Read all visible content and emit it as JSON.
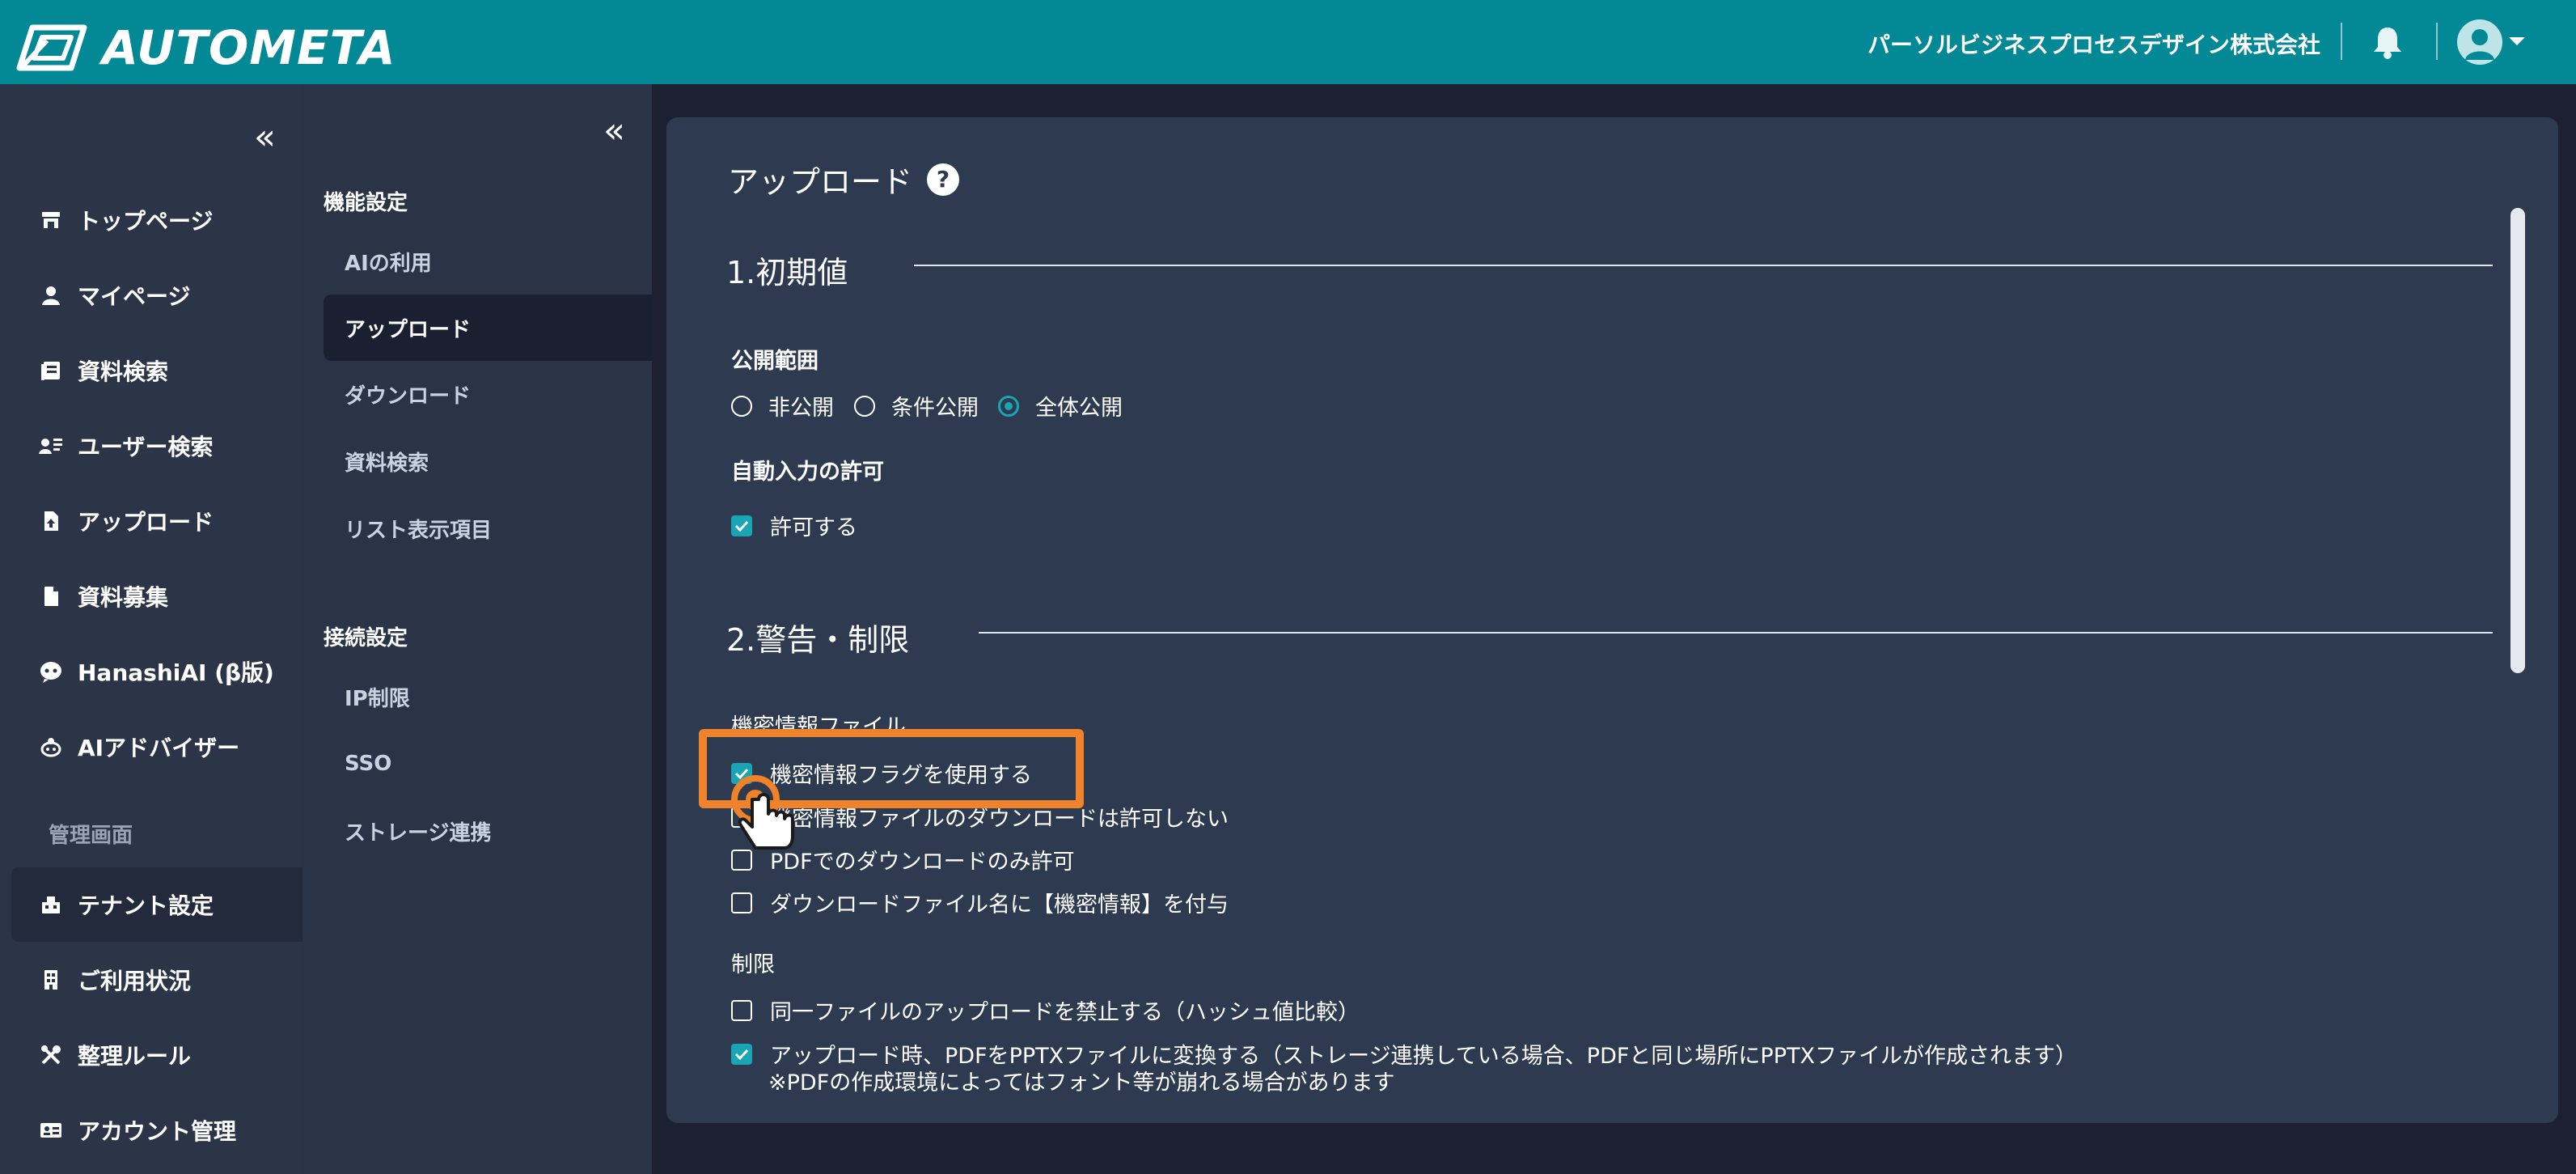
{
  "header": {
    "brand": "AUTOMETA",
    "company": "パーソルビジネスプロセスデザイン株式会社",
    "colors": {
      "bar": "#038895",
      "accent": "#1aa5b4",
      "highlight": "#f08229"
    },
    "icons": [
      "logo-icon",
      "bell-icon",
      "user-avatar-icon",
      "caret-down-icon"
    ]
  },
  "sidebar": {
    "collapse_label": "«",
    "items": [
      {
        "label": "トップページ",
        "icon": "store-icon"
      },
      {
        "label": "マイページ",
        "icon": "person-icon"
      },
      {
        "label": "資料検索",
        "icon": "document-search-icon"
      },
      {
        "label": "ユーザー検索",
        "icon": "user-search-icon"
      },
      {
        "label": "アップロード",
        "icon": "file-upload-icon"
      },
      {
        "label": "資料募集",
        "icon": "file-icon"
      },
      {
        "label": "HanashiAI (β版)",
        "icon": "chat-bot-icon"
      },
      {
        "label": "AIアドバイザー",
        "icon": "advisor-icon"
      }
    ],
    "admin_section": "管理画面",
    "admin_items": [
      {
        "label": "テナント設定",
        "icon": "tenant-icon",
        "active": true
      },
      {
        "label": "ご利用状況",
        "icon": "building-icon"
      },
      {
        "label": "整理ルール",
        "icon": "tools-icon"
      },
      {
        "label": "アカウント管理",
        "icon": "id-card-icon"
      }
    ]
  },
  "subnav": {
    "collapse_label": "«",
    "group1": "機能設定",
    "group1_items": [
      "AIの利用",
      "アップロード",
      "ダウンロード",
      "資料検索",
      "リスト表示項目"
    ],
    "active": "アップロード",
    "group2": "接続設定",
    "group2_items": [
      "IP制限",
      "SSO",
      "ストレージ連携"
    ]
  },
  "main": {
    "title": "アップロード",
    "help": "?",
    "section1": "1.初期値",
    "visibility_label": "公開範囲",
    "visibility_options": [
      "非公開",
      "条件公開",
      "全体公開"
    ],
    "visibility_selected": "全体公開",
    "auto_input_label": "自動入力の許可",
    "auto_input_option": "許可する",
    "auto_input_checked": true,
    "section2": "2.警告・制限",
    "confidential_label": "機密情報ファイル",
    "confidential_options": [
      {
        "label": "機密情報フラグを使用する",
        "checked": true
      },
      {
        "label": "機密情報ファイルのダウンロードは許可しない",
        "checked": false
      },
      {
        "label": "PDFでのダウンロードのみ許可",
        "checked": false
      },
      {
        "label": "ダウンロードファイル名に【機密情報】を付与",
        "checked": false
      }
    ],
    "restriction_label": "制限",
    "restriction_options": [
      {
        "label": "同一ファイルのアップロードを禁止する（ハッシュ値比較）",
        "checked": false
      },
      {
        "label": "アップロード時、PDFをPPTXファイルに変換する（ストレージ連携している場合、PDFと同じ場所にPPTXファイルが作成されます）",
        "checked": true
      }
    ],
    "restriction_note": "※PDFの作成環境によってはフォント等が崩れる場合があります"
  }
}
